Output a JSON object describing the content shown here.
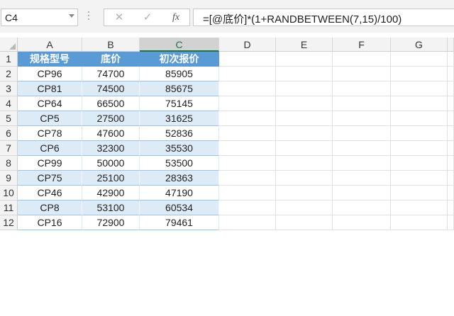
{
  "formula_bar": {
    "name_box": "C4",
    "cancel_icon": "close-icon",
    "enter_icon": "check-icon",
    "function_label": "fx",
    "formula": "=[@底价]*(1+RANDBETWEEN(7,15)/100)"
  },
  "sheet": {
    "selected_cell": "C4",
    "column_headers": [
      "A",
      "B",
      "C",
      "D",
      "E",
      "F",
      "G"
    ],
    "row_headers": [
      "1",
      "2",
      "3",
      "4",
      "5",
      "6",
      "7",
      "8",
      "9",
      "10",
      "11",
      "12"
    ],
    "table": {
      "header_color": "#5b9bd5",
      "band_color": "#ddebf7",
      "headers": [
        "规格型号",
        "底价",
        "初次报价"
      ],
      "rows": [
        [
          "CP96",
          "74700",
          "85905"
        ],
        [
          "CP81",
          "74500",
          "85675"
        ],
        [
          "CP64",
          "66500",
          "75145"
        ],
        [
          "CP5",
          "27500",
          "31625"
        ],
        [
          "CP78",
          "47600",
          "52836"
        ],
        [
          "CP6",
          "32300",
          "35530"
        ],
        [
          "CP99",
          "50000",
          "53500"
        ],
        [
          "CP75",
          "25100",
          "28363"
        ],
        [
          "CP46",
          "42900",
          "47190"
        ],
        [
          "CP8",
          "53100",
          "60534"
        ],
        [
          "CP16",
          "72900",
          "79461"
        ]
      ]
    }
  }
}
